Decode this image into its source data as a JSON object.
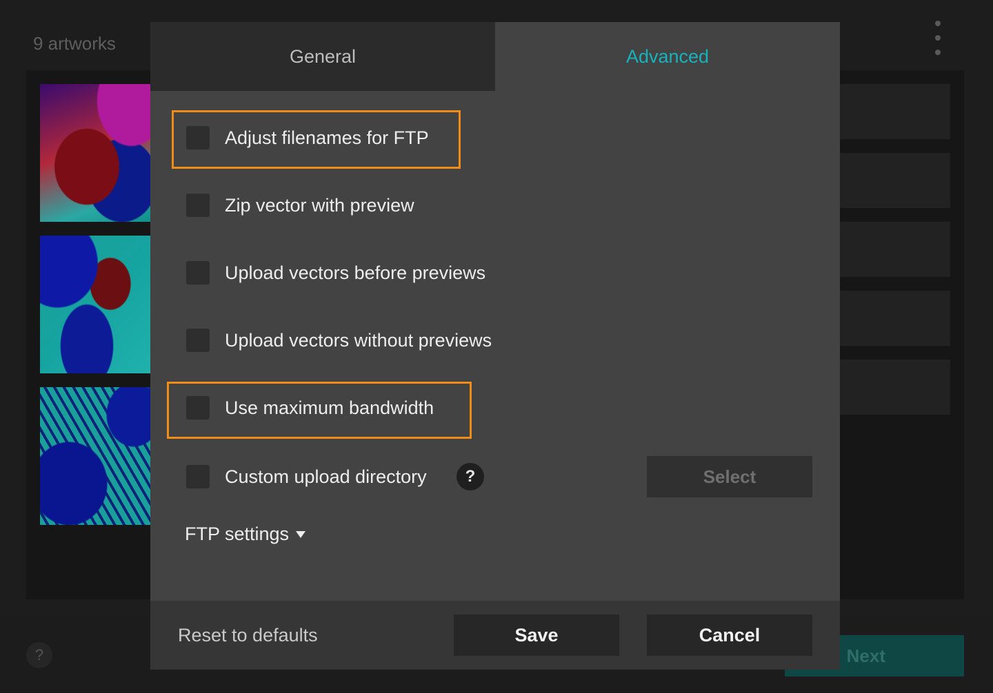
{
  "background": {
    "artwork_count": "9 artworks",
    "help_glyph": "?",
    "next_label": "Next"
  },
  "dialog": {
    "tabs": [
      {
        "label": "General",
        "active": false
      },
      {
        "label": "Advanced",
        "active": true
      }
    ],
    "options": [
      {
        "label": "Adjust filenames for FTP",
        "checked": false,
        "highlighted": true
      },
      {
        "label": "Zip vector with preview",
        "checked": false,
        "highlighted": false
      },
      {
        "label": "Upload vectors before previews",
        "checked": false,
        "highlighted": false
      },
      {
        "label": "Upload vectors without previews",
        "checked": false,
        "highlighted": false
      },
      {
        "label": "Use maximum bandwidth",
        "checked": false,
        "highlighted": true
      },
      {
        "label": "Custom upload directory",
        "checked": false,
        "highlighted": false
      }
    ],
    "help_glyph": "?",
    "select_label": "Select",
    "ftp_settings_label": "FTP settings",
    "footer": {
      "reset_label": "Reset to defaults",
      "save_label": "Save",
      "cancel_label": "Cancel"
    }
  },
  "colors": {
    "accent": "#17b3bd",
    "highlight": "#f08c18",
    "dialog_bg": "#434343"
  }
}
